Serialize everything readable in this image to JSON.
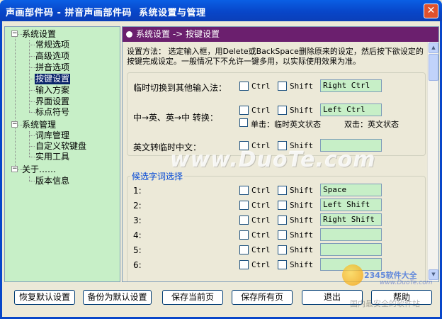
{
  "window": {
    "title": "声画部件码 - 拼音声画部件码  系统设置与管理",
    "close_glyph": "✕"
  },
  "tree": {
    "groups": [
      {
        "label": "系统设置",
        "expander": "−",
        "items": [
          "常规选项",
          "高级选项",
          "拼音选项",
          "按键设置",
          "输入方案",
          "界面设置",
          "标点符号"
        ]
      },
      {
        "label": "系统管理",
        "expander": "−",
        "items": [
          "词库管理",
          "自定义软键盘",
          "实用工具"
        ]
      },
      {
        "label": "关于……",
        "expander": "−",
        "items": [
          "版本信息"
        ]
      }
    ],
    "selected": "按键设置"
  },
  "panel": {
    "header": "系统设置 -> 按键设置",
    "description": "设置方法：  选定输入框，用Delete或BackSpace删除原来的设定，然后按下欲设定的按键完成设定。一般情况下不允许一键多用，以实际使用效果为准。",
    "rows": [
      {
        "label": "临时切换到其他输入法：",
        "ctrl": "Ctrl",
        "shift": "Shift",
        "key": "Right Ctrl"
      },
      {
        "label": "中→英、英→中 转换：",
        "ctrl": "Ctrl",
        "shift": "Shift",
        "key": "Left Ctrl"
      },
      {
        "label": "英文转临时中文：",
        "ctrl": "Ctrl",
        "shift": "Shift",
        "key": ""
      }
    ],
    "radio_single": "单击：临时英文状态",
    "radio_double": "双击：英文状态",
    "candidate_group_title": "候选字词选择",
    "candidates": [
      {
        "label": "1:",
        "ctrl": "Ctrl",
        "shift": "Shift",
        "key": "Space"
      },
      {
        "label": "2:",
        "ctrl": "Ctrl",
        "shift": "Shift",
        "key": "Left Shift"
      },
      {
        "label": "3:",
        "ctrl": "Ctrl",
        "shift": "Shift",
        "key": "Right Shift"
      },
      {
        "label": "4:",
        "ctrl": "Ctrl",
        "shift": "Shift",
        "key": ""
      },
      {
        "label": "5:",
        "ctrl": "Ctrl",
        "shift": "Shift",
        "key": ""
      },
      {
        "label": "6:",
        "ctrl": "Ctrl",
        "shift": "Shift",
        "key": ""
      }
    ]
  },
  "buttons": {
    "restore_default": "恢复默认设置",
    "backup_default": "备份为默认设置",
    "save_current": "保存当前页",
    "save_all": "保存所有页",
    "exit": "退出",
    "help": "帮助"
  },
  "watermarks": {
    "main": "www.DuoTe.com",
    "small": "www.DuoTe.com",
    "brand": "2345软件大全",
    "brand2": "国内最安全的软件站"
  },
  "colors": {
    "tree_bg": "#c7efc7",
    "header_bg": "#6b1f6e",
    "titlebar": "#0846c9"
  }
}
